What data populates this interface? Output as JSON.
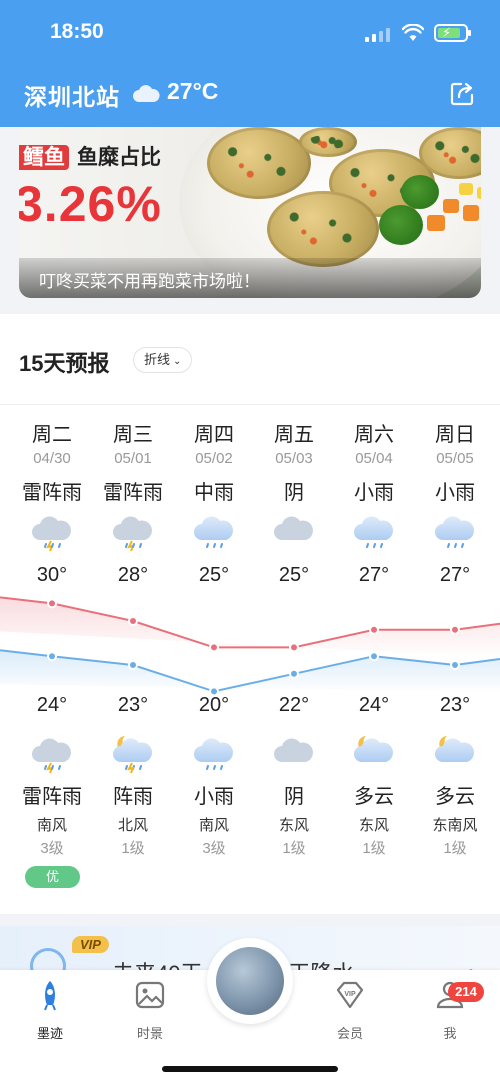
{
  "status_bar": {
    "time": "18:50"
  },
  "header": {
    "location": "深圳北站",
    "temperature": "27°C",
    "weather_icon": "cloud-icon",
    "share_icon": "share-icon"
  },
  "banner": {
    "tag": "鳕鱼",
    "headline_rest": "鱼糜占比",
    "percent": "3.26%",
    "caption": "叮咚买菜不用再跑菜市场啦！"
  },
  "forecast": {
    "title": "15天预报",
    "view_toggle": "折线",
    "days": [
      {
        "weekday": "周二",
        "date": "04/30",
        "day_cond": "雷阵雨",
        "day_icon": "thunderstorm-icon",
        "night_cond": "雷阵雨",
        "night_icon": "thunderstorm-icon",
        "wind": "南风",
        "level": "3级"
      },
      {
        "weekday": "周三",
        "date": "05/01",
        "day_cond": "雷阵雨",
        "day_icon": "thunderstorm-icon",
        "night_cond": "阵雨",
        "night_icon": "night-shower-icon",
        "wind": "北风",
        "level": "1级"
      },
      {
        "weekday": "周四",
        "date": "05/02",
        "day_cond": "中雨",
        "day_icon": "rain-icon",
        "night_cond": "小雨",
        "night_icon": "rain-icon",
        "wind": "南风",
        "level": "3级"
      },
      {
        "weekday": "周五",
        "date": "05/03",
        "day_cond": "阴",
        "day_icon": "cloud-icon",
        "night_cond": "阴",
        "night_icon": "cloud-icon",
        "wind": "东风",
        "level": "1级"
      },
      {
        "weekday": "周六",
        "date": "05/04",
        "day_cond": "小雨",
        "day_icon": "rain-icon",
        "night_cond": "多云",
        "night_icon": "partly-cloudy-night-icon",
        "wind": "东风",
        "level": "1级"
      },
      {
        "weekday": "周日",
        "date": "05/05",
        "day_cond": "小雨",
        "day_icon": "rain-icon",
        "night_cond": "多云",
        "night_icon": "partly-cloudy-night-icon",
        "wind": "东南风",
        "level": "1级"
      }
    ],
    "aqi_label": "优"
  },
  "chart_data": {
    "type": "line",
    "x": [
      "04/30",
      "05/01",
      "05/02",
      "05/03",
      "05/04",
      "05/05"
    ],
    "series": [
      {
        "values": [
          30,
          28,
          25,
          25,
          27,
          27
        ],
        "color": "#e8707a"
      },
      {
        "values": [
          24,
          23,
          20,
          22,
          24,
          23
        ],
        "color": "#6aaee8"
      }
    ],
    "high_labels": [
      "30°",
      "28°",
      "25°",
      "25°",
      "27°",
      "27°"
    ],
    "low_labels": [
      "24°",
      "23°",
      "20°",
      "22°",
      "24°",
      "23°"
    ]
  },
  "promo": {
    "badge": "VIP",
    "text": "未来40天 29°C 37天降水"
  },
  "tabs": [
    {
      "label": "墨迹",
      "icon": "rocket-icon",
      "active": true
    },
    {
      "label": "时景",
      "icon": "image-icon",
      "active": false
    },
    {
      "label": "会员",
      "icon": "vip-diamond-icon",
      "active": false
    },
    {
      "label": "我",
      "icon": "profile-icon",
      "active": false
    }
  ],
  "notifications": {
    "count": "214"
  },
  "colors": {
    "header_blue": "#4a9ff0",
    "high_line": "#e8707a",
    "low_line": "#6aaee8",
    "aqi_green": "#62c887",
    "badge_red": "#f0443f"
  }
}
